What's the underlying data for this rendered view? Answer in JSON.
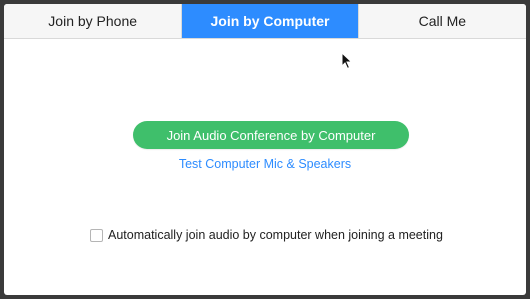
{
  "tabs": [
    {
      "label": "Join by Phone",
      "active": false
    },
    {
      "label": "Join by Computer",
      "active": true
    },
    {
      "label": "Call Me",
      "active": false
    }
  ],
  "main": {
    "join_button_label": "Join Audio Conference by Computer",
    "test_link_label": "Test Computer Mic & Speakers",
    "auto_join_label": "Automatically join audio by computer when joining a meeting",
    "auto_join_checked": false
  },
  "colors": {
    "accent_blue": "#2d8cff",
    "join_green": "#3fbf6b"
  },
  "icons": [
    "mouse-pointer-icon"
  ]
}
